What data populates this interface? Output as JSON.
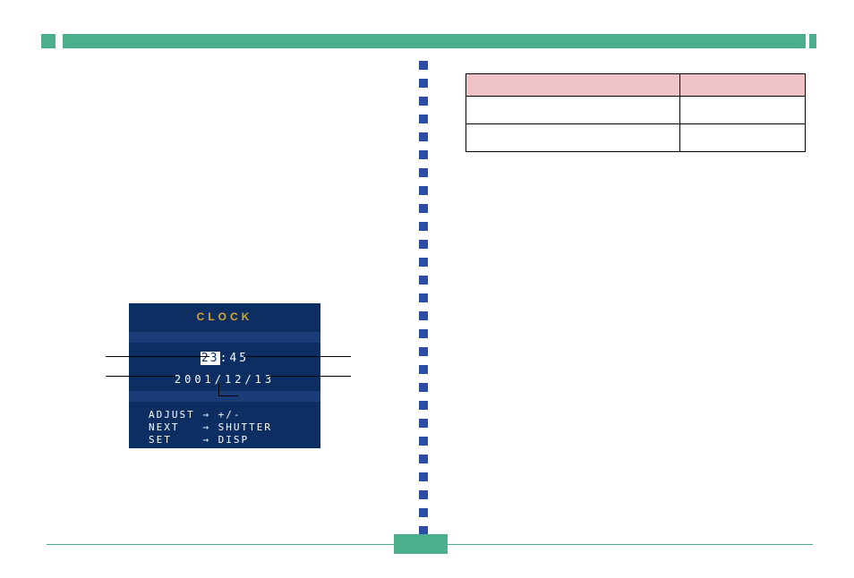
{
  "lcd": {
    "title": "CLOCK",
    "hour_highlighted": "23",
    "minute": "45",
    "date": "2001/12/13",
    "help": {
      "adjust_label": "ADJUST",
      "adjust_value": "+/-",
      "next_label": "NEXT",
      "next_value": "SHUTTER",
      "set_label": "SET",
      "set_value": "DISP"
    }
  },
  "table": {
    "header": [
      "",
      ""
    ],
    "rows": [
      [
        "",
        ""
      ],
      [
        "",
        ""
      ]
    ]
  },
  "colors": {
    "green": "#4aaf8a",
    "blue_square": "#2a4da6",
    "lcd_bg": "#0c2e63",
    "lcd_band": "#1a3d78",
    "lcd_title": "#d6a82a",
    "table_header": "#eec2c6"
  },
  "arrow_glyph": "→"
}
